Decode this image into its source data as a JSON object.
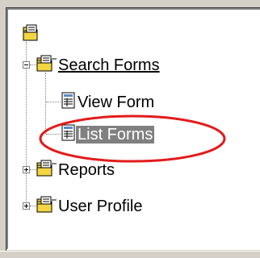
{
  "tree": {
    "items": [
      {
        "label": "Search Forms",
        "state": "expanded"
      },
      {
        "label": "View Form"
      },
      {
        "label": "List Forms",
        "selected": true
      },
      {
        "label": "Reports",
        "state": "collapsed"
      },
      {
        "label": "User Profile",
        "state": "collapsed"
      }
    ]
  },
  "annotation": {
    "ellipse_color": "#e21b1b"
  },
  "colors": {
    "folder_yellow": "#f2d541",
    "selection_bg": "#808080"
  }
}
